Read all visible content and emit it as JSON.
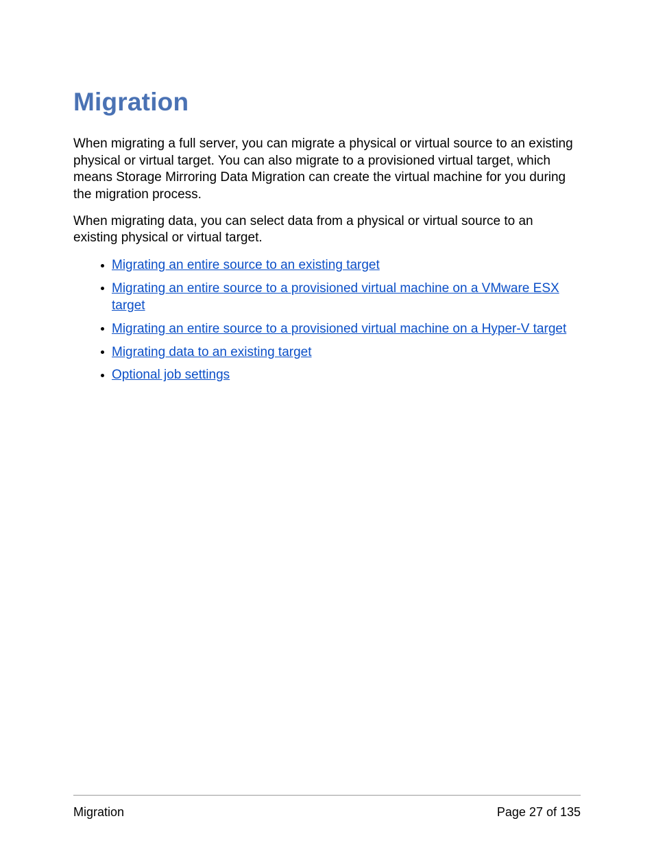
{
  "title": "Migration",
  "paragraphs": [
    "When migrating a full server, you can migrate a physical or virtual source to an existing physical or virtual target.  You can also migrate to a provisioned virtual target, which means Storage Mirroring Data Migration can create the virtual machine for you during the migration process.",
    "When migrating data, you can select data from a physical or virtual source to an existing physical or virtual target."
  ],
  "links": [
    "Migrating an entire source to an existing target",
    "Migrating an entire source to a provisioned virtual machine on a VMware ESX target",
    "Migrating an entire source to a provisioned virtual machine on a Hyper-V target",
    "Migrating data to an existing target",
    "Optional job settings"
  ],
  "footer": {
    "section": "Migration",
    "page_label": "Page 27 of 135"
  }
}
